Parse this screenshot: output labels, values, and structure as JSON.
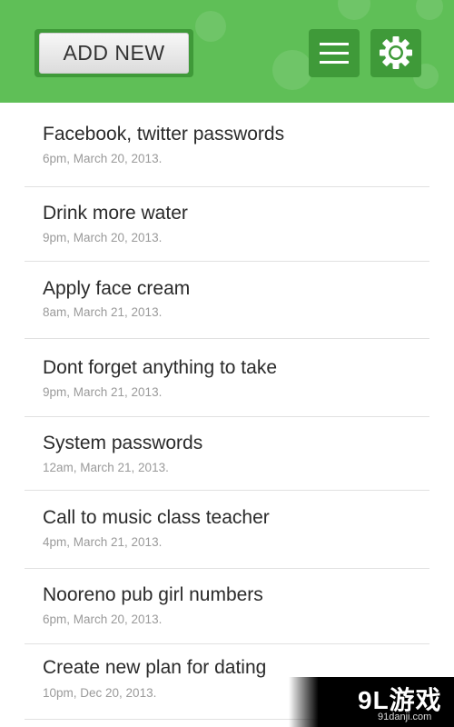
{
  "header": {
    "add_new_label": "ADD NEW",
    "accent_color": "#5fbf57",
    "button_dark_color": "#3f9a39",
    "menu_icon": "hamburger-menu-icon",
    "settings_icon": "gear-icon"
  },
  "notes": [
    {
      "title": "Facebook, twitter passwords",
      "time": "6pm, March 20, 2013."
    },
    {
      "title": "Drink more water",
      "time": "9pm, March 20, 2013."
    },
    {
      "title": "Apply face cream",
      "time": "8am, March 21, 2013."
    },
    {
      "title": "Dont forget anything to take",
      "time": "9pm, March 21, 2013."
    },
    {
      "title": "System passwords",
      "time": "12am, March 21, 2013."
    },
    {
      "title": "Call to music class teacher",
      "time": "4pm, March 21, 2013."
    },
    {
      "title": "Nooreno pub girl numbers",
      "time": "6pm, March 20, 2013."
    },
    {
      "title": "Create new plan for dating",
      "time": "10pm, Dec 20, 2013."
    }
  ],
  "watermark": {
    "main": "9L游戏",
    "sub": "91danji.com"
  }
}
